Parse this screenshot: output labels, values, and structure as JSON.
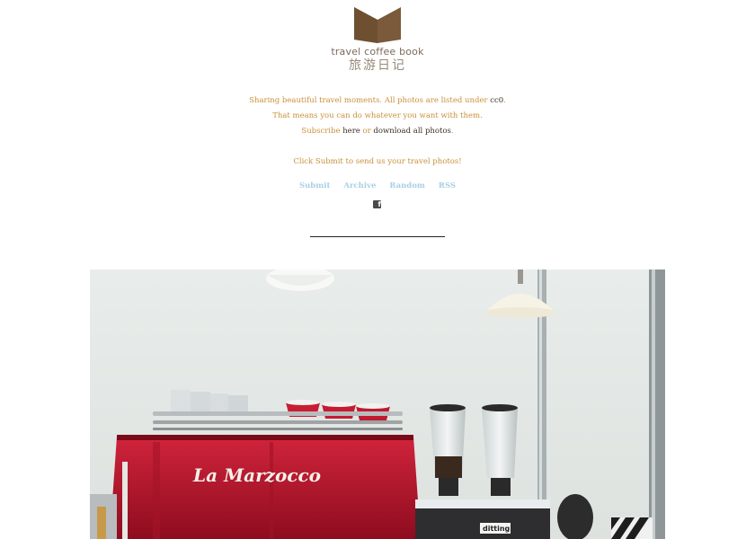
{
  "logo": {
    "title": "travel coffee book",
    "subtitle_cn": "旅游日记",
    "brand_color": "#7a5a3a"
  },
  "description": {
    "line1_text": "Sharing beautiful travel moments. All photos are listed under ",
    "line1_link": "cc0",
    "line1_end": ".",
    "line2": "That means you can do whatever you want with them.",
    "line3_text": "Subscribe ",
    "line3_link1": "here",
    "line3_mid": " or ",
    "line3_link2": "download all photos",
    "line3_end": ".",
    "submit_note": "Click Submit to send us your travel photos!"
  },
  "nav": {
    "items": [
      "Submit",
      "Archive",
      "Random",
      "RSS"
    ]
  },
  "social": {
    "icon": "facebook-icon",
    "glyph": "f"
  },
  "post": {
    "photo_subject": "espresso-machine-photo",
    "machine_brand": "La Marzocco",
    "grinder_label": "ditting"
  },
  "colors": {
    "accent": "#c9903a",
    "link_dark": "#3a2e22",
    "nav": "#a8cfe6",
    "machine_red": "#b8102a"
  }
}
